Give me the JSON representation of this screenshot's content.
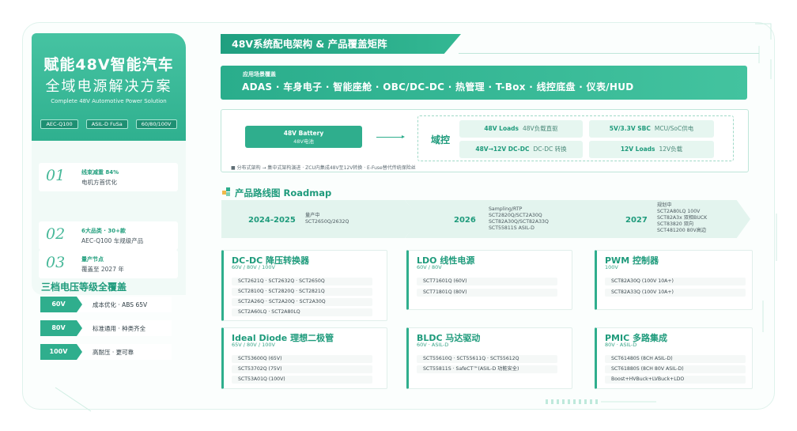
{
  "left": {
    "title_line1": "赋能48V智能汽车",
    "title_line2": "全域电源解决方案",
    "subtitle": "Complete 48V Automotive Power Solution",
    "tags": [
      "AEC-Q100",
      "ASIL-D FuSa",
      "60/80/100V"
    ],
    "stats": [
      {
        "num": "01",
        "t1": "线束减重 84%",
        "t2": "电机方首优化"
      },
      {
        "num": "02",
        "t1": "6大品类 · 30+款",
        "t2": "AEC-Q100 车规级产品"
      },
      {
        "num": "03",
        "t1": "量产节点",
        "t2": "覆盖至 2027 年"
      }
    ],
    "volt_title": "三档电压等级全覆盖",
    "volts": [
      {
        "tag": "60V",
        "text": "成本优化 · ABS 65V"
      },
      {
        "tag": "80V",
        "text": "标准通用 · 种类齐全"
      },
      {
        "tag": "100V",
        "text": "高耐压 · 更可靠"
      }
    ]
  },
  "header": {
    "title": "48V系统配电架构 & 产品覆盖矩阵"
  },
  "apps": {
    "label": "应用场景覆盖",
    "list": "ADAS · 车身电子 · 智能座舱 · OBC/DC-DC · 热管理 · T-Box · 线控底盘 · 仪表/HUD"
  },
  "arch": {
    "battery_t1": "48V Battery",
    "battery_t2": "48V电池",
    "domain_label": "域控",
    "cells": [
      {
        "b": "48V Loads",
        "s": "48V负载直驱"
      },
      {
        "b": "5V/3.3V SBC",
        "s": "MCU/SoC供电"
      },
      {
        "b": "48V→12V DC-DC",
        "s": "DC-DC 转换"
      },
      {
        "b": "12V Loads",
        "s": "12V负载"
      }
    ],
    "note": "■ 分布式架构 → 集中式架构演进 · ZCU内集成48V至12V转换 · E-Fuse替代传统保险丝"
  },
  "roadmap": {
    "title": "产品路线图 Roadmap",
    "phases": [
      {
        "year": "2024-2025",
        "lines": [
          "量产中",
          "SCT2650Q/2632Q"
        ]
      },
      {
        "year": "2026",
        "lines": [
          "Sampling/RTP",
          "SCT2820Q/SCT2A30Q",
          "SCT82A30Q/SCT82A33Q",
          "SCT55811S ASIL-D"
        ]
      },
      {
        "year": "2027",
        "lines": [
          "规划中",
          "SCT2A80LQ 100V",
          "SCT82A3x 双相BUCK",
          "SCT83820 双向",
          "SCT481200 80V高边"
        ]
      }
    ]
  },
  "cards": [
    {
      "title": "DC-DC 降压转换器",
      "sub": "60V / 80V / 100V",
      "rows": [
        "SCT2621Q · SCT2632Q · SCT2650Q",
        "SCT2810Q · SCT2820Q · SCT2821Q",
        "SCT2A26Q · SCT2A20Q · SCT2A30Q",
        "SCT2A60LQ · SCT2A80LQ"
      ]
    },
    {
      "title": "LDO 线性电源",
      "sub": "60V / 80V",
      "rows": [
        "SCT71601Q (60V)",
        "SCT71801Q (80V)"
      ]
    },
    {
      "title": "PWM 控制器",
      "sub": "100V",
      "rows": [
        "SCT82A30Q (100V 10A+)",
        "SCT82A33Q (100V 10A+)"
      ]
    },
    {
      "title": "Ideal Diode 理想二极管",
      "sub": "65V / 80V / 100V",
      "rows": [
        "SCT53600Q (65V)",
        "SCT53702Q (75V)",
        "SCT53A01Q (100V)"
      ]
    },
    {
      "title": "BLDC 马达驱动",
      "sub": "60V · ASIL-D",
      "rows": [
        "SCT55610Q · SCT55611Q · SCT55612Q",
        "SCT55811S · SafeCT™(ASIL-D 功能安全)"
      ]
    },
    {
      "title": "PMIC 多路集成",
      "sub": "80V · ASIL-D",
      "rows": [
        "SCT61480S (8CH ASIL-D)",
        "SCT61880S (8CH 80V ASIL-D)",
        "Boost+HVBuck+LVBuck+LDO"
      ]
    }
  ],
  "colors": {
    "accent": "#2fae8d",
    "accent_dark": "#1f9b7c",
    "light_bg": "#e3f4ee"
  }
}
